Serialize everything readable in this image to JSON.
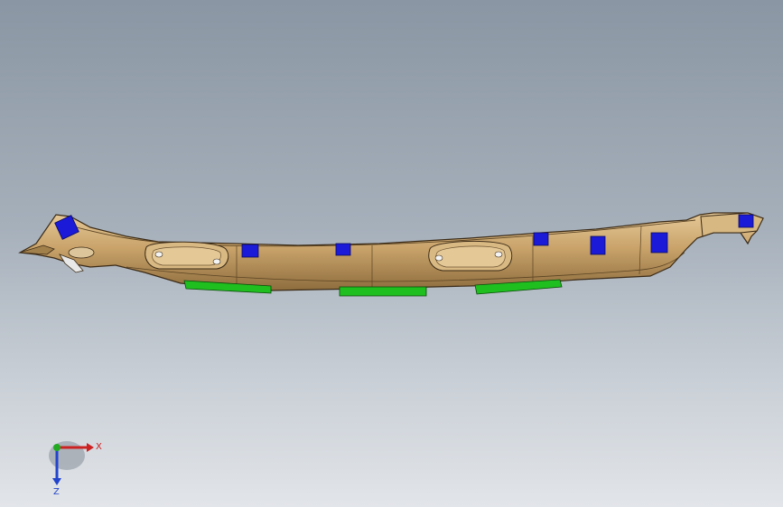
{
  "viewport": {
    "background_top": "#8a96a3",
    "background_bottom": "#e2e5e9"
  },
  "model": {
    "body_color": "#c8a46c",
    "clip_color": "#1a1ad8",
    "pad_color": "#1fbf1f",
    "outline_color": "#3a2a16"
  },
  "triad": {
    "x_label": "X",
    "z_label": "Z",
    "x_color": "#cc2222",
    "y_color": "#22aa22",
    "z_color": "#2244cc"
  }
}
